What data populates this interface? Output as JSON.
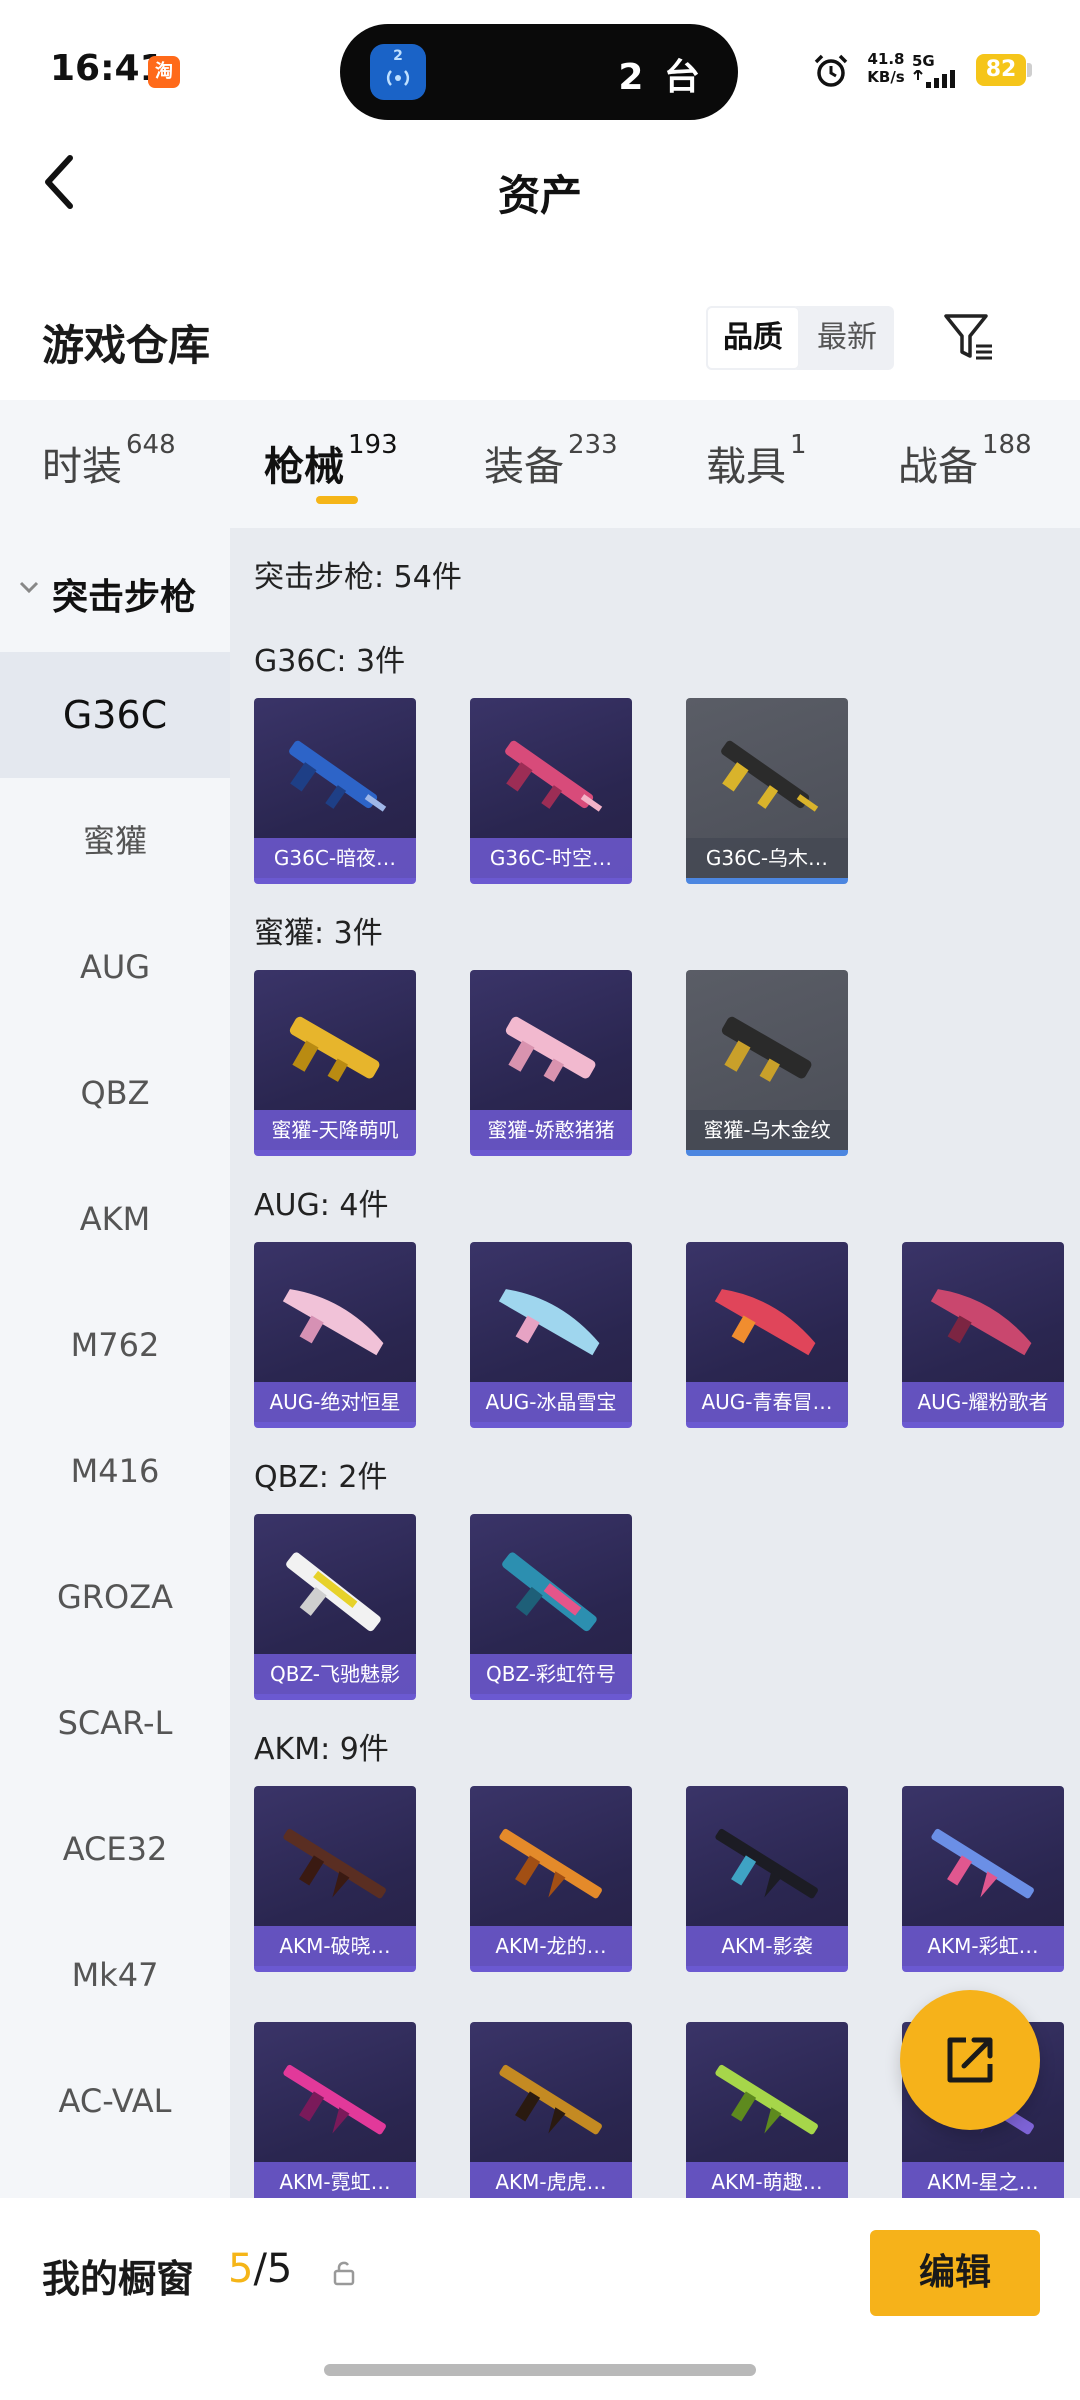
{
  "status_bar": {
    "time": "16:41",
    "island_badge": "2",
    "island_text": "2 台",
    "net_speed_value": "41.8",
    "net_speed_unit": "KB/s",
    "network": "5G",
    "battery": "82"
  },
  "header": {
    "title": "资产"
  },
  "warehouse": {
    "title": "游戏仓库",
    "sort_options": [
      "品质",
      "最新"
    ],
    "sort_active": "品质"
  },
  "tabs": [
    {
      "label": "时装",
      "count": "648"
    },
    {
      "label": "枪械",
      "count": "193"
    },
    {
      "label": "装备",
      "count": "233"
    },
    {
      "label": "载具",
      "count": "1"
    },
    {
      "label": "战备",
      "count": "188"
    }
  ],
  "active_tab": "枪械",
  "sidebar": {
    "group": "突击步枪",
    "items": [
      "G36C",
      "蜜獾",
      "AUG",
      "QBZ",
      "AKM",
      "M762",
      "M416",
      "GROZA",
      "SCAR-L",
      "ACE32",
      "Mk47",
      "AC-VAL"
    ],
    "active": "G36C"
  },
  "main": {
    "summary": "突击步枪: 54件",
    "sections": [
      {
        "head": "G36C: 3件",
        "items": [
          "G36C-暗夜…",
          "G36C-时空…",
          "G36C-乌木…"
        ]
      },
      {
        "head": "蜜獾: 3件",
        "items": [
          "蜜獾-天降萌叽",
          "蜜獾-娇憨猪猪",
          "蜜獾-乌木金纹"
        ]
      },
      {
        "head": "AUG: 4件",
        "items": [
          "AUG-绝对恒星",
          "AUG-冰晶雪宝",
          "AUG-青春冒…",
          "AUG-耀粉歌者"
        ]
      },
      {
        "head": "QBZ: 2件",
        "items": [
          "QBZ-飞驰魅影",
          "QBZ-彩虹符号"
        ]
      },
      {
        "head": "AKM: 9件",
        "items": [
          "AKM-破晓…",
          "AKM-龙的…",
          "AKM-影袭",
          "AKM-彩虹…",
          "AKM-霓虹…",
          "AKM-虎虎…",
          "AKM-萌趣…",
          "AKM-星之…"
        ]
      }
    ]
  },
  "bottom": {
    "showcase_label": "我的橱窗",
    "showcase_current": "5",
    "showcase_total": "/5",
    "edit_label": "编辑"
  },
  "colors": {
    "accent": "#f6b21a",
    "card_purple": "#2a2650",
    "card_gray": "#4b4e57"
  }
}
